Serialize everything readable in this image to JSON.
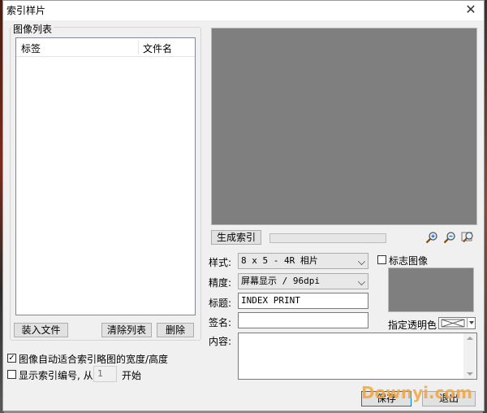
{
  "window": {
    "title": "索引样片",
    "close_glyph": "✕"
  },
  "image_list": {
    "group_label": "图像列表",
    "columns": [
      "标签",
      "文件名"
    ],
    "buttons": {
      "add_files": "装入文件",
      "clear_list": "清除列表",
      "delete": "删除"
    }
  },
  "options": {
    "auto_fit": {
      "label": "图像自动适合索引略图的宽度/高度",
      "checked": true
    },
    "show_numbers": {
      "label": "显示索引编号, 从",
      "checked": false,
      "start_value": "1",
      "suffix": "开始"
    }
  },
  "preview": {
    "generate_button": "生成索引",
    "zoom_in_icon": "zoom-in-icon",
    "zoom_out_icon": "zoom-out-icon",
    "fit_icon": "zoom-fit-icon"
  },
  "form": {
    "style_label": "样式:",
    "style_value": "8 x 5 - 4R 相片",
    "quality_label": "精度:",
    "quality_value": "屏幕显示 / 96dpi",
    "title_label": "标题:",
    "title_value": "INDEX PRINT",
    "caption_label": "签名:",
    "caption_value": "",
    "content_label": "内容:",
    "content_value": ""
  },
  "logo": {
    "checkbox_label": "标志图像",
    "checked": false,
    "transparent_label": "指定透明色"
  },
  "footer": {
    "save_button": "保存",
    "exit_button": "退出"
  },
  "watermark": "Downyi.com",
  "colors": {
    "preview_bg": "#7f7f7f",
    "dialog_bg": "#f0f0f0",
    "default_border": "#0078d7",
    "watermark": "#f4a53a"
  }
}
